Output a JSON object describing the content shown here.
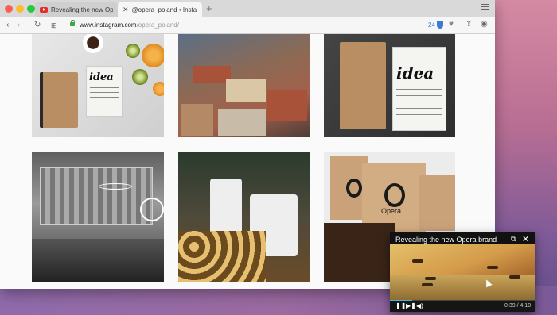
{
  "browser": {
    "tabs": [
      {
        "label": "Revealing the new Opera bra",
        "icon": "youtube-icon"
      },
      {
        "label": "@opera_poland • Instagram p",
        "icon": "close-icon"
      }
    ],
    "newtab_label": "+",
    "url_domain": "www.instagram.com",
    "url_path": "/opera_poland/",
    "badge_count": "24"
  },
  "photos": [
    {
      "name": "flatlay-idea-newspaper",
      "text": "idea"
    },
    {
      "name": "wroclaw-aerial-square"
    },
    {
      "name": "notebook-idea-newspaper",
      "text": "idea"
    },
    {
      "name": "building-light-painting"
    },
    {
      "name": "chefs-plating-food"
    },
    {
      "name": "opera-paper-bags",
      "text": "Opera"
    }
  ],
  "video_popout": {
    "title": "Revealing the new Opera brand",
    "time": "0:39 / 4:10",
    "progress": 0.156
  },
  "colors": {
    "accent": "#3fb8e6",
    "youtube_red": "#e52d27",
    "secure_green": "#3aa84a"
  }
}
